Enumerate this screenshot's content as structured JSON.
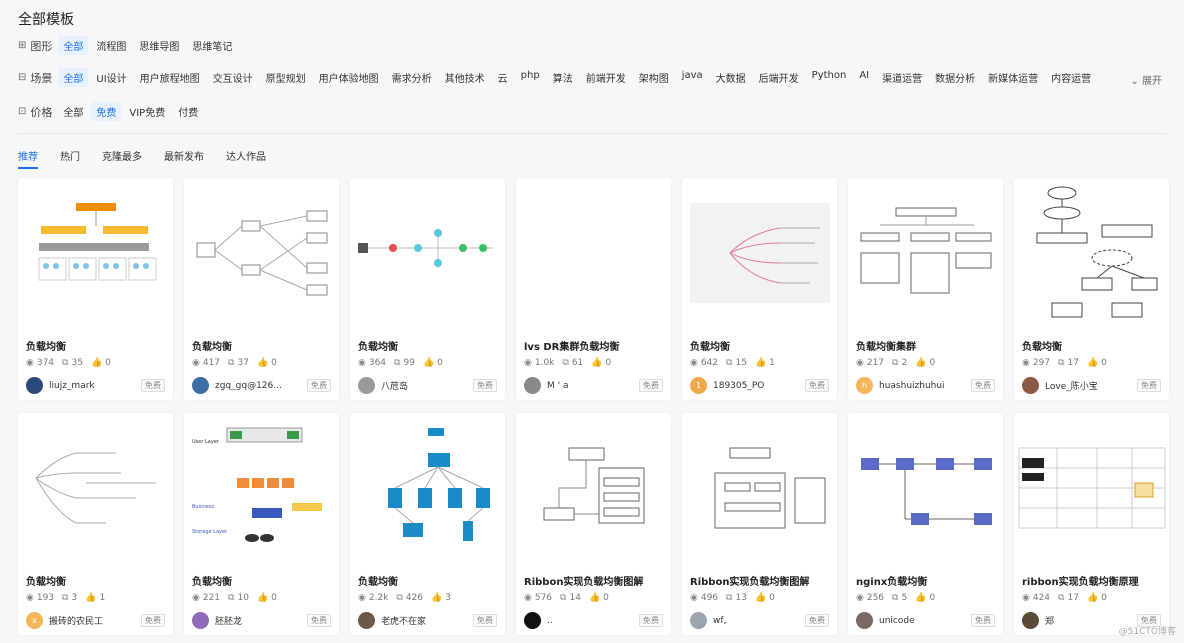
{
  "page_title": "全部模板",
  "filters": {
    "shape": {
      "label": "图形",
      "icon": "grid-icon",
      "options": [
        "全部",
        "流程图",
        "思维导图",
        "思维笔记"
      ],
      "active": 0
    },
    "scene": {
      "label": "场景",
      "icon": "scene-icon",
      "options": [
        "全部",
        "UI设计",
        "用户旅程地图",
        "交互设计",
        "原型规划",
        "用户体验地图",
        "需求分析",
        "其他技术",
        "云",
        "php",
        "算法",
        "前端开发",
        "架构图",
        "java",
        "大数据",
        "后端开发",
        "Python",
        "AI",
        "渠道运营",
        "数据分析",
        "新媒体运营",
        "内容运营"
      ],
      "active": 0
    },
    "price": {
      "label": "价格",
      "icon": "price-icon",
      "options": [
        "全部",
        "免费",
        "VIP免费",
        "付费"
      ],
      "active": 1
    },
    "expand_label": "展开"
  },
  "tabs": {
    "items": [
      "推荐",
      "热门",
      "克隆最多",
      "最新发布",
      "达人作品"
    ],
    "active": 0
  },
  "cards": [
    {
      "title": "负载均衡",
      "views": "374",
      "clones": "35",
      "likes": "0",
      "author": "liujz_mark",
      "avatar_color": "#2b4a7a",
      "avatar_text": "",
      "badge": "免费",
      "thumb": "orgchart"
    },
    {
      "title": "负载均衡",
      "views": "417",
      "clones": "37",
      "likes": "0",
      "author": "zgq_gq@126...",
      "avatar_color": "#3a6ea5",
      "avatar_text": "",
      "badge": "免费",
      "thumb": "lines"
    },
    {
      "title": "负载均衡",
      "views": "364",
      "clones": "99",
      "likes": "0",
      "author": "八苊岛",
      "avatar_color": "#999999",
      "avatar_text": "",
      "badge": "免费",
      "thumb": "network"
    },
    {
      "title": "lvs DR集群负载均衡",
      "views": "1.0k",
      "clones": "61",
      "likes": "0",
      "author": "M ' a",
      "avatar_color": "#888888",
      "avatar_text": "",
      "badge": "免费",
      "thumb": "blank"
    },
    {
      "title": "负载均衡",
      "views": "642",
      "clones": "15",
      "likes": "1",
      "author": "189305_PO",
      "avatar_color": "#f0a94a",
      "avatar_text": "1",
      "badge": "免费",
      "thumb": "mindmap"
    },
    {
      "title": "负载均衡集群",
      "views": "217",
      "clones": "2",
      "likes": "0",
      "author": "huashuizhuhui",
      "avatar_color": "#f5b55a",
      "avatar_text": "h",
      "badge": "免费",
      "thumb": "tree"
    },
    {
      "title": "负载均衡",
      "views": "297",
      "clones": "17",
      "likes": "0",
      "author": "Love_陈小宝",
      "avatar_color": "#8a5a44",
      "avatar_text": "",
      "badge": "免费",
      "thumb": "flow"
    },
    {
      "title": "负载均衡",
      "views": "193",
      "clones": "3",
      "likes": "1",
      "author": "搬砖的农民工",
      "avatar_color": "#f5b55a",
      "avatar_text": "x",
      "badge": "免费",
      "thumb": "mind2"
    },
    {
      "title": "负载均衡",
      "views": "221",
      "clones": "10",
      "likes": "0",
      "author": "胚胚龙",
      "avatar_color": "#8e6bb8",
      "avatar_text": "",
      "badge": "免费",
      "thumb": "layers"
    },
    {
      "title": "负载均衡",
      "views": "2.2k",
      "clones": "426",
      "likes": "3",
      "author": "老虎不在家",
      "avatar_color": "#6b5a4a",
      "avatar_text": "",
      "badge": "免费",
      "thumb": "cluster"
    },
    {
      "title": "Ribbon实现负载均衡图解",
      "views": "576",
      "clones": "14",
      "likes": "0",
      "author": "..",
      "avatar_color": "#111111",
      "avatar_text": "",
      "badge": "免费",
      "thumb": "boxes"
    },
    {
      "title": "Ribbon实现负载均衡图解",
      "views": "496",
      "clones": "13",
      "likes": "0",
      "author": "wf,",
      "avatar_color": "#9aa5b0",
      "avatar_text": "",
      "badge": "免费",
      "thumb": "boxes2"
    },
    {
      "title": "nginx负载均衡",
      "views": "256",
      "clones": "5",
      "likes": "0",
      "author": "unicode",
      "avatar_color": "#7a6a60",
      "avatar_text": "",
      "badge": "免费",
      "thumb": "nginx"
    },
    {
      "title": "ribbon实现负载均衡原理",
      "views": "424",
      "clones": "17",
      "likes": "0",
      "author": "郑",
      "avatar_color": "#5a4a3a",
      "avatar_text": "",
      "badge": "免费",
      "thumb": "wide"
    }
  ],
  "watermark": "@51CTO博客"
}
